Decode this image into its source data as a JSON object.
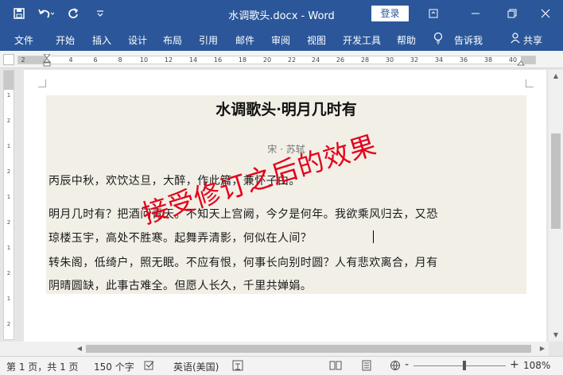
{
  "titlebar": {
    "doc_title": "水调歌头.docx  -  Word",
    "login_label": "登录",
    "qat_icons": [
      "save-icon",
      "undo-icon",
      "redo-icon",
      "customize-icon"
    ],
    "window_icons": [
      "ribbon-display-icon",
      "minimize-icon",
      "restore-icon",
      "close-icon"
    ],
    "accent": "#2b579a"
  },
  "tabs": [
    "文件",
    "开始",
    "插入",
    "设计",
    "布局",
    "引用",
    "邮件",
    "审阅",
    "视图",
    "开发工具",
    "帮助"
  ],
  "tell_me": "告诉我",
  "share": "共享",
  "ruler": {
    "numbers": [
      "2",
      "2",
      "4",
      "6",
      "8",
      "10",
      "12",
      "14",
      "16",
      "18",
      "20",
      "22",
      "24",
      "26",
      "28",
      "30",
      "32",
      "34",
      "36",
      "38",
      "40"
    ],
    "vertical_numbers": [
      "1",
      "2",
      "1",
      "2",
      "1",
      "2",
      "1",
      "2",
      "1",
      "2",
      "1"
    ]
  },
  "document": {
    "heading": "水调歌头·明月几时有",
    "author": "宋 · 苏轼",
    "lines": [
      "丙辰中秋，欢饮达旦，大醉，作此篇，兼怀子由。",
      "明月几时有？把酒问青天。不知天上宫阙，今夕是何年。我欲乘风归去，又恐",
      "琼楼玉宇，高处不胜寒。起舞弄清影，何似在人间？",
      "转朱阁，低绮户，照无眠。不应有恨，何事长向别时圆？人有悲欢离合，月有",
      "阴晴圆缺，此事古难全。但愿人长久，千里共婵娟。"
    ],
    "overlay_text": "接受修订之后的效果",
    "overlay_color": "#e4001b",
    "shade_color": "#f1efe6"
  },
  "statusbar": {
    "page": "第 1 页，共 1 页",
    "words": "150 个字",
    "language": "英语(美国)",
    "zoom": "108%",
    "zoom_minus": "-",
    "zoom_plus": "+"
  }
}
